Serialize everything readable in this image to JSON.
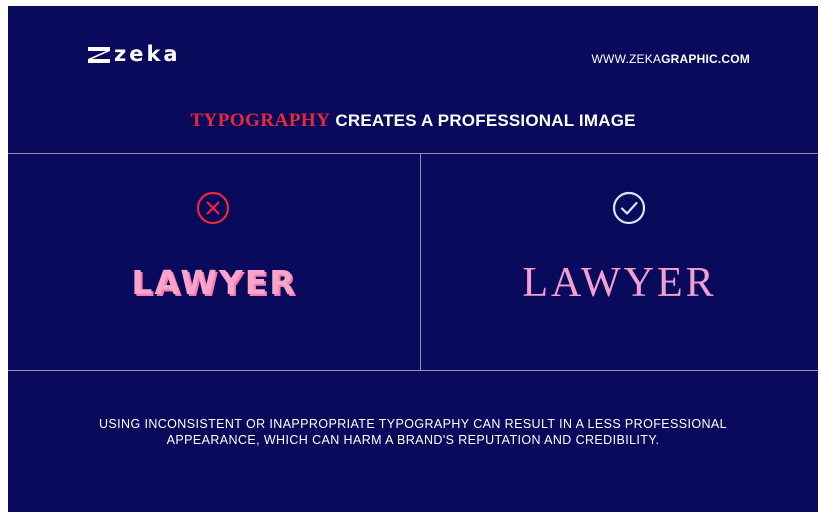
{
  "brand": {
    "logo_text": "zeka",
    "website_light": "WWW.ZEKA",
    "website_bold": "GRAPHIC.COM"
  },
  "headline": {
    "accent": "TYPOGRAPHY",
    "rest": " CREATES A PROFESSIONAL IMAGE",
    "accent_color": "#e8273a"
  },
  "comparison": {
    "bad": {
      "icon": "x-circle-icon",
      "word": "LAWYER",
      "icon_color": "#e8273a"
    },
    "good": {
      "icon": "check-circle-icon",
      "word": "LAWYER",
      "icon_color": "#d4e8f5"
    }
  },
  "caption": {
    "line1": "USING INCONSISTENT OR INAPPROPRIATE TYPOGRAPHY CAN RESULT IN A LESS PROFESSIONAL",
    "line2": "APPEARANCE, WHICH CAN HARM A BRAND'S REPUTATION AND CREDIBILITY."
  },
  "colors": {
    "background": "#0a0a5c",
    "text": "#ffffff",
    "word_pink": "#f1a0d0"
  }
}
